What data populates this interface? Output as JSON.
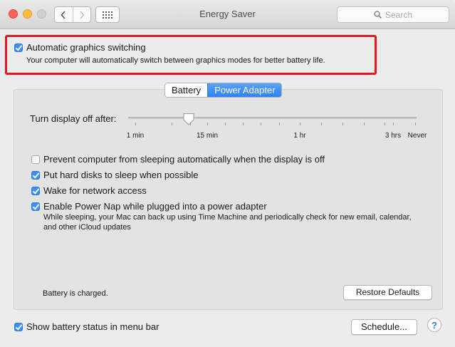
{
  "window": {
    "title": "Energy Saver",
    "search_placeholder": "Search"
  },
  "graphics": {
    "label": "Automatic graphics switching",
    "checked": true,
    "description": "Your computer will automatically switch between graphics modes for better battery life."
  },
  "tabs": [
    {
      "label": "Battery",
      "selected": false
    },
    {
      "label": "Power Adapter",
      "selected": true
    }
  ],
  "display_off": {
    "label": "Turn display off after:",
    "tick_labels": [
      "1 min",
      "15 min",
      "1 hr",
      "3 hrs",
      "Never"
    ],
    "current": "15 min"
  },
  "options": [
    {
      "label": "Prevent computer from sleeping automatically when the display is off",
      "checked": false
    },
    {
      "label": "Put hard disks to sleep when possible",
      "checked": true
    },
    {
      "label": "Wake for network access",
      "checked": true
    },
    {
      "label": "Enable Power Nap while plugged into a power adapter",
      "checked": true
    }
  ],
  "power_nap_description": "While sleeping, your Mac can back up using Time Machine and periodically check for new email, calendar, and other iCloud updates",
  "battery_status": "Battery is charged.",
  "restore_defaults_label": "Restore Defaults",
  "show_battery": {
    "label": "Show battery status in menu bar",
    "checked": true
  },
  "schedule_label": "Schedule...",
  "help_label": "?",
  "colors": {
    "accent": "#3d8ff2",
    "highlight_box": "#e0191c"
  }
}
